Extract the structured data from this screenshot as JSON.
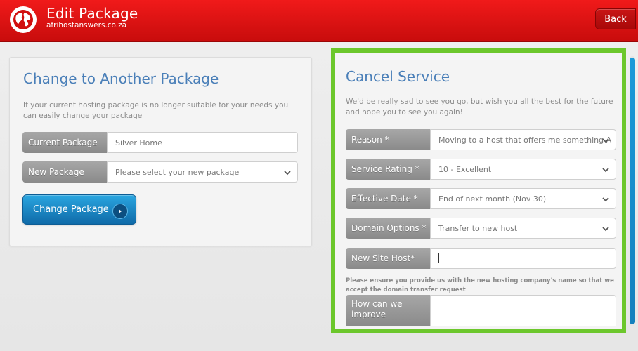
{
  "header": {
    "title": "Edit Package",
    "subtitle": "afrihostanswers.co.za",
    "back_label": "Back",
    "brand_color": "#e01212"
  },
  "change_package": {
    "title": "Change to Another Package",
    "description": "If your current hosting package is no longer suitable for your needs you can easily change your package",
    "current_package": {
      "label": "Current Package",
      "value": "Silver Home"
    },
    "new_package": {
      "label": "New Package",
      "placeholder": "Please select your new package"
    },
    "button_label": "Change Package"
  },
  "cancel_service": {
    "title": "Cancel Service",
    "description": "We'd be really sad to see you go, but wish you all the best for the future and hope you to see you again!",
    "reason": {
      "label": "Reason *",
      "value": "Moving to a host that offers me something A"
    },
    "service_rating": {
      "label": "Service Rating *",
      "value": "10 - Excellent"
    },
    "effective_date": {
      "label": "Effective Date *",
      "value": "End of next month (Nov 30)"
    },
    "domain_options": {
      "label": "Domain Options *",
      "value": "Transfer to new host"
    },
    "new_site_host": {
      "label": "New Site Host*",
      "value": ""
    },
    "note": "Please ensure you provide us with the new hosting company's name so that we accept the domain transfer request",
    "improve": {
      "label": "How can we improve",
      "value": ""
    },
    "highlight_color": "#6cc72c"
  }
}
